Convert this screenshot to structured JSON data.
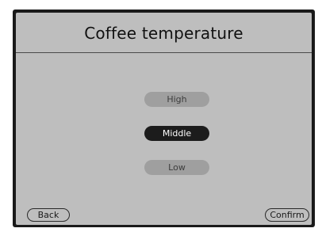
{
  "header": {
    "title": "Coffee temperature"
  },
  "options": [
    {
      "label": "High",
      "selected": false
    },
    {
      "label": "Middle",
      "selected": true
    },
    {
      "label": "Low",
      "selected": false
    }
  ],
  "footer": {
    "back_label": "Back",
    "confirm_label": "Confirm"
  },
  "colors": {
    "screen_background": "#bebebe",
    "selected_option": "#1c1c1c",
    "unselected_option": "#9f9f9f",
    "frame": "#1a1a1a"
  }
}
